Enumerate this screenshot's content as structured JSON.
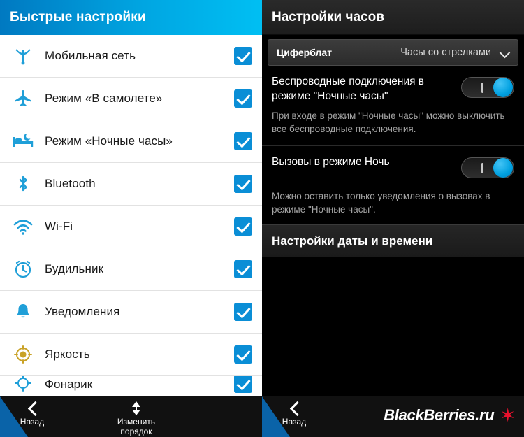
{
  "left": {
    "header": {
      "title": "Быстрые настройки"
    },
    "items": [
      {
        "label": "Мобильная сеть",
        "icon": "cellular-signal-icon",
        "checked": true
      },
      {
        "label": "Режим «В самолете»",
        "icon": "airplane-icon",
        "checked": true
      },
      {
        "label": "Режим «Ночные часы»",
        "icon": "bed-icon",
        "checked": true
      },
      {
        "label": "Bluetooth",
        "icon": "bluetooth-icon",
        "checked": true
      },
      {
        "label": "Wi-Fi",
        "icon": "wifi-icon",
        "checked": true
      },
      {
        "label": "Будильник",
        "icon": "alarm-clock-icon",
        "checked": true
      },
      {
        "label": "Уведомления",
        "icon": "bell-icon",
        "checked": true
      },
      {
        "label": "Яркость",
        "icon": "brightness-icon",
        "checked": true
      },
      {
        "label": "Фонарик",
        "icon": "flashlight-icon",
        "checked": true
      }
    ],
    "bottom": {
      "back_label": "Назад",
      "reorder_label": "Изменить порядок"
    }
  },
  "right": {
    "header": {
      "title": "Настройки часов"
    },
    "dial": {
      "label": "Циферблат",
      "value": "Часы со стрелками"
    },
    "settings": [
      {
        "title": "Беспроводные подключения в режиме \"Ночные часы\"",
        "description": "При входе в режим \"Ночные часы\" можно выключить все беспроводные подключения.",
        "toggle_on": true
      },
      {
        "title": "Вызовы в режиме Ночь",
        "description": "Можно оставить только уведомления о вызовах в режиме \"Ночные часы\".",
        "toggle_on": true
      }
    ],
    "date_section": {
      "title": "Настройки даты и времени"
    },
    "bottom": {
      "back_label": "Назад",
      "brand_text": "BlackBerries.ru",
      "brand_star": "✶"
    }
  },
  "colors": {
    "accent_blue": "#00a6e2",
    "check_blue": "#0a8ed6",
    "brand_red": "#e8112d",
    "panel_dark": "#000000"
  }
}
